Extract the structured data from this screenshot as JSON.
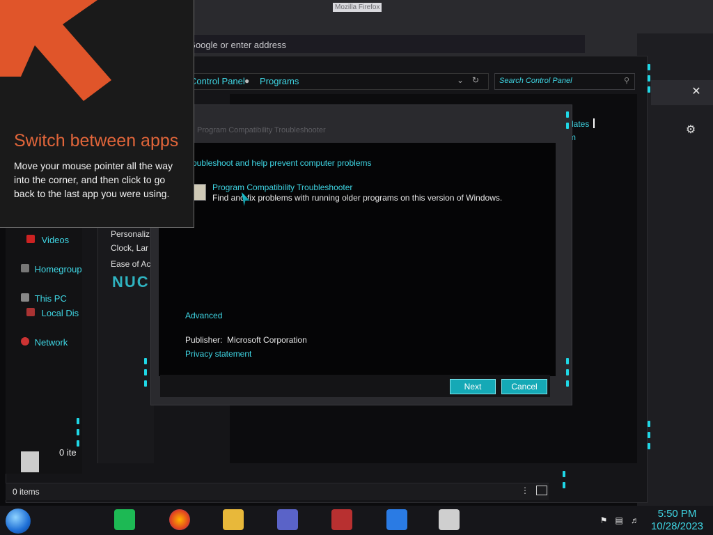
{
  "firefox": {
    "title": "Mozilla Firefox",
    "url_placeholder": "Search with Google or enter address",
    "url_text": "n Google or enter address"
  },
  "explorer": {
    "breadcrumb_1": "Control Panel",
    "breadcrumb_2": "Programs",
    "search_placeholder": "Search Control Panel",
    "right_links": [
      "dates",
      "m"
    ],
    "nav_items": [
      {
        "label": "Videos",
        "icon": "video-icon"
      },
      {
        "label": "Homegroup",
        "icon": "homegroup-icon"
      },
      {
        "label": "This PC",
        "icon": "computer-icon"
      },
      {
        "label": "Local Dis",
        "icon": "drive-icon"
      },
      {
        "label": "Network",
        "icon": "network-icon"
      }
    ],
    "mid_items": [
      "Personaliz",
      "Clock, Lar",
      "Ease of Ac"
    ],
    "status_items": "0 items",
    "status_items_2": "0 ite"
  },
  "dialog": {
    "title": "Program Compatibility Troubleshooter",
    "heading": "roubleshoot and help prevent computer problems",
    "item_title": "Program Compatibility Troubleshooter",
    "item_desc": "Find and fix problems with running older programs on this version of Windows.",
    "advanced": "Advanced",
    "publisher_label": "Publisher:",
    "publisher_value": "Microsoft Corporation",
    "privacy": "Privacy statement",
    "next": "Next",
    "cancel": "Cancel"
  },
  "tip": {
    "title": "Switch between apps",
    "body": "Move your mouse pointer all the way into the corner, and then click to go back to the last app you were using."
  },
  "taskbar": {
    "time": "5:50 PM",
    "date": "10/28/2023"
  },
  "colors": {
    "accent": "#3fd6e4",
    "tip_title": "#e0653a",
    "button": "#15a9b6"
  }
}
